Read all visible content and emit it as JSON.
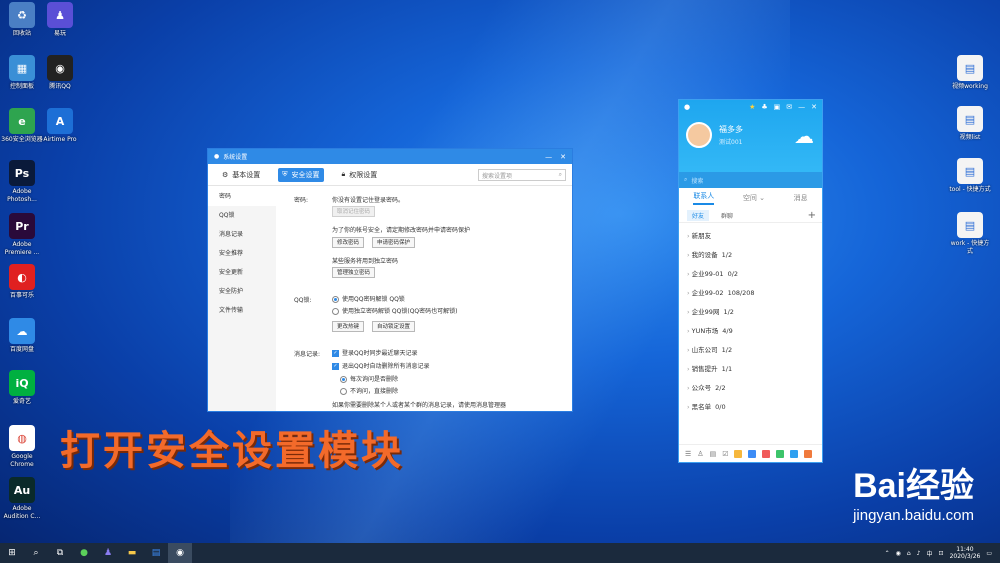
{
  "desktop_left": [
    {
      "label": "回收站",
      "color": "#4a7fc4",
      "glyph": "♻"
    },
    {
      "label": "易玩",
      "color": "#5a4fd6",
      "glyph": "♟"
    },
    {
      "label": "控制面板",
      "color": "#3a8fd6",
      "glyph": "▦"
    },
    {
      "label": "腾讯QQ",
      "color": "#222222",
      "glyph": "◉"
    },
    {
      "label": "360安全浏览器",
      "color": "#2ea44f",
      "glyph": "e"
    },
    {
      "label": "Airtime Pro",
      "color": "#1d6fd6",
      "glyph": "A"
    },
    {
      "label": "Adobe Photosh...",
      "color": "#0a1a3a",
      "glyph": "Ps"
    },
    {
      "label": "Adobe Premiere ...",
      "color": "#2a0a3a",
      "glyph": "Pr"
    },
    {
      "label": "百事可乐",
      "color": "#e02020",
      "glyph": "◐"
    },
    {
      "label": "百度网盘",
      "color": "#2f8ae6",
      "glyph": "☁"
    },
    {
      "label": "爱奇艺",
      "color": "#00b040",
      "glyph": "iQ"
    },
    {
      "label": "Google Chrome",
      "color": "#ffffff",
      "glyph": "◍"
    },
    {
      "label": "Adobe Audition C...",
      "color": "#0a2a2a",
      "glyph": "Au"
    }
  ],
  "desktop_right": [
    {
      "label": "视频working"
    },
    {
      "label": "视频list"
    },
    {
      "label": "tool - 快捷方式"
    },
    {
      "label": "work - 快捷方式"
    }
  ],
  "settings": {
    "title": "系统设置",
    "tabs": [
      "基本设置",
      "安全设置",
      "权限设置"
    ],
    "search_placeholder": "搜索设置项",
    "sidebar": [
      "密码",
      "QQ锁",
      "消息记录",
      "安全推荐",
      "安全更新",
      "安全防护",
      "文件传输"
    ],
    "password_label": "密码:",
    "password_text": "你没有设置记住登录密码。",
    "cancel_remember": "取消记住密码",
    "protect_text": "为了你的帐号安全，请定期修改密码并申请密码保护",
    "change_password": "修改密码",
    "apply_protect": "申请密码保护",
    "independent_text": "某些服务将用到独立密码",
    "manage_independent": "管理独立密码",
    "lock_label": "QQ锁:",
    "lock_opt1": "使用QQ密码解锁 QQ锁",
    "lock_opt2": "使用独立密码解锁 QQ锁(QQ密码也可解锁)",
    "change_hotkey": "更改热键",
    "auto_lock": "自动锁定设置",
    "msg_label": "消息记录:",
    "msg_opt1": "登录QQ时同步最近聊天记录",
    "msg_opt2": "退出QQ时自动删除所有消息记录",
    "msg_sub1": "每次询问是否删除",
    "msg_sub2": "不询问，直接删除",
    "msg_note": "如果你需要删除某个人或者某个群的消息记录，请使用消息管理器"
  },
  "qq": {
    "nickname": "福多多",
    "signature": "测试001",
    "search_placeholder": "搜索",
    "tabs": [
      "联系人",
      "空间",
      "消息"
    ],
    "subtabs": [
      "好友",
      "群聊"
    ],
    "groups": [
      {
        "name": "新朋友",
        "count": ""
      },
      {
        "name": "我的设备",
        "count": "1/2"
      },
      {
        "name": "企业99-01",
        "count": "0/2"
      },
      {
        "name": "企业99-02",
        "count": "108/208"
      },
      {
        "name": "企业99网",
        "count": "1/2"
      },
      {
        "name": "YUN市场",
        "count": "4/9"
      },
      {
        "name": "山东公司",
        "count": "1/2"
      },
      {
        "name": "销售提升",
        "count": "1/1"
      },
      {
        "name": "公众号",
        "count": "2/2"
      },
      {
        "name": "黑名单",
        "count": "0/0"
      }
    ]
  },
  "overlay_text": "打开安全设置模块",
  "watermark": {
    "brand": "Bai经验",
    "site": "jingyan.baidu.com"
  },
  "clock": {
    "time": "11:40",
    "date": "2020/3/26"
  },
  "tray_text": "中"
}
